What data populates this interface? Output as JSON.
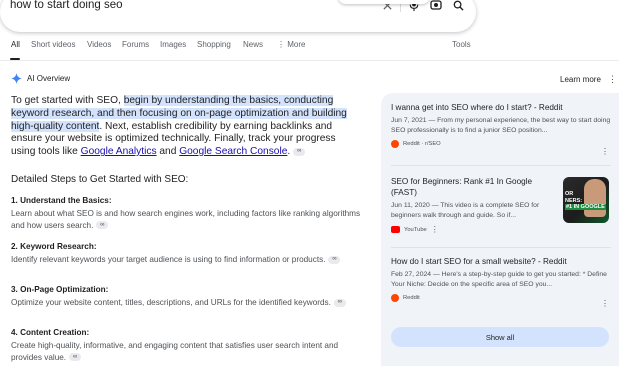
{
  "search": {
    "query": "how to start doing seo"
  },
  "tabs": [
    {
      "label": "All",
      "active": true
    },
    {
      "label": "Short videos"
    },
    {
      "label": "Videos"
    },
    {
      "label": "Forums"
    },
    {
      "label": "Images"
    },
    {
      "label": "Shopping"
    },
    {
      "label": "News"
    },
    {
      "label": "More",
      "icon": "more-vert-icon"
    },
    {
      "label": "Tools"
    }
  ],
  "ai_overview": {
    "heading": "AI Overview",
    "learn_more": "Learn more",
    "intro": {
      "p1": "To get started with SEO, ",
      "highlight": "begin by understanding the basics, conducting keyword research, and then focusing on on-page optimization and building high-quality content",
      "p2": ". Next, establish credibility by earning backlinks and ensure your website is optimized technically. Finally, track your progress using tools like ",
      "link1": "Google Analytics",
      "and": " and ",
      "link2": "Google Search Console",
      "end": "."
    },
    "steps_heading": "Detailed Steps to Get Started with SEO:",
    "steps": [
      {
        "title": "1. Understand the Basics:",
        "body": "Learn about what SEO is and how search engines work, including factors like ranking algorithms and how users search."
      },
      {
        "title": "2. Keyword Research:",
        "body": "Identify relevant keywords your target audience is using to find information or products."
      },
      {
        "title": "3. On-Page Optimization:",
        "body": "Optimize your website content, titles, descriptions, and URLs for the identified keywords."
      },
      {
        "title": "4. Content Creation:",
        "body": "Create high-quality, informative, and engaging content that satisfies user search intent and provides value."
      }
    ]
  },
  "sources": [
    {
      "title": "I wanna get into SEO where do I start? - Reddit",
      "snippet": "Jun 7, 2021 — From my personal experience, the best way to start doing SEO professionally is to find a junior SEO position...",
      "source": "Reddit · r/SEO",
      "icon": "reddit-icon",
      "color": "#ff4500"
    },
    {
      "title": "SEO for Beginners: Rank #1 In Google (FAST)",
      "snippet": "Jun 11, 2020 — This video is a complete SEO for beginners walk through and guide. So if...",
      "source": "YouTube",
      "icon": "youtube-icon",
      "color": "#ff0000",
      "thumb_text_1": "OR",
      "thumb_text_2": "NERS:",
      "thumb_text_3": "#1 IN GOOGLE"
    },
    {
      "title": "How do I start SEO for a small website? - Reddit",
      "snippet": "Feb 27, 2024 — Here's a step-by-step guide to get you started: * Define Your Niche: Decide on the specific area of SEO you...",
      "source": "Reddit",
      "icon": "reddit-icon",
      "color": "#ff4500"
    }
  ],
  "show_all": "Show all"
}
